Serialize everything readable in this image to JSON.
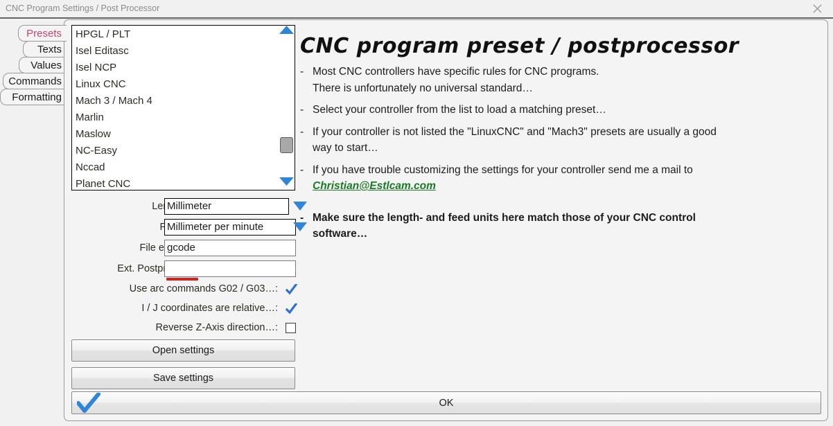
{
  "window": {
    "title": "CNC Program Settings / Post Processor",
    "close_icon": "close-icon"
  },
  "tabs": [
    {
      "label": "Presets",
      "active": true
    },
    {
      "label": "Texts",
      "active": false
    },
    {
      "label": "Values",
      "active": false
    },
    {
      "label": "Commands",
      "active": false
    },
    {
      "label": "Formatting",
      "active": false
    }
  ],
  "preset_list": {
    "items": [
      "HPGL / PLT",
      "Isel Editasc",
      "Isel NCP",
      "Linux CNC",
      "Mach 3 / Mach 4",
      "Marlin",
      "Maslow",
      "NC-Easy",
      "Nccad",
      "Planet CNC"
    ],
    "scroll_up_icon": "triangle-up-icon",
    "scroll_down_icon": "triangle-down-icon",
    "scroll_thumb": "scrollbar-thumb"
  },
  "fields": [
    {
      "label": "Length unit:",
      "value": "Millimeter",
      "type": "combo",
      "arrow_icon": "chevron-down-icon"
    },
    {
      "label": "Feed unit:",
      "value": "Millimeter per minute",
      "type": "combo",
      "arrow_icon": "chevron-down-icon"
    },
    {
      "label": "File extension:",
      "value": "gcode",
      "type": "text",
      "spellcheck_error": true
    },
    {
      "label": "Ext. Postprocessor:",
      "value": "",
      "type": "text",
      "spellcheck_error": false
    }
  ],
  "checkboxes": [
    {
      "label": "Use arc commands G02 / G03…:",
      "checked": true
    },
    {
      "label": "I / J coordinates are relative…:",
      "checked": true
    },
    {
      "label": "Reverse Z-Axis direction…:",
      "checked": false
    }
  ],
  "buttons": {
    "open_settings": "Open settings",
    "save_settings": "Save settings",
    "ok": "OK",
    "ok_icon": "blue-checkmark-icon"
  },
  "doc": {
    "title": "CNC  program  preset  /  postprocessor",
    "paragraphs": [
      {
        "line1": "Most CNC controllers have specific rules for CNC programs.",
        "line2": "There is unfortunately no universal standard…",
        "bold": false
      },
      {
        "line1": "Select your controller from the list to load a matching preset…",
        "line2": "",
        "bold": false
      },
      {
        "line1": "If your controller is not listed the \"LinuxCNC\" and \"Mach3\" presets are usually a good",
        "line2": "way to start…",
        "bold": false
      },
      {
        "line1": "If you have trouble customizing the settings for your controller send me a mail to",
        "line2": "",
        "link": "Christian@Estlcam.com",
        "bold": false
      },
      {
        "line1": "Make sure the length- and feed units here match those of your CNC control",
        "line2": "software…",
        "bold": true
      }
    ],
    "dash": "-"
  },
  "colors": {
    "accent_blue": "#2f86d6",
    "active_tab": "#c4456c",
    "link_green": "#1a7a24",
    "spell_error_red": "#d81d1d",
    "panel_bg": "#f4f4f4",
    "window_bg": "#f1f1f1"
  }
}
